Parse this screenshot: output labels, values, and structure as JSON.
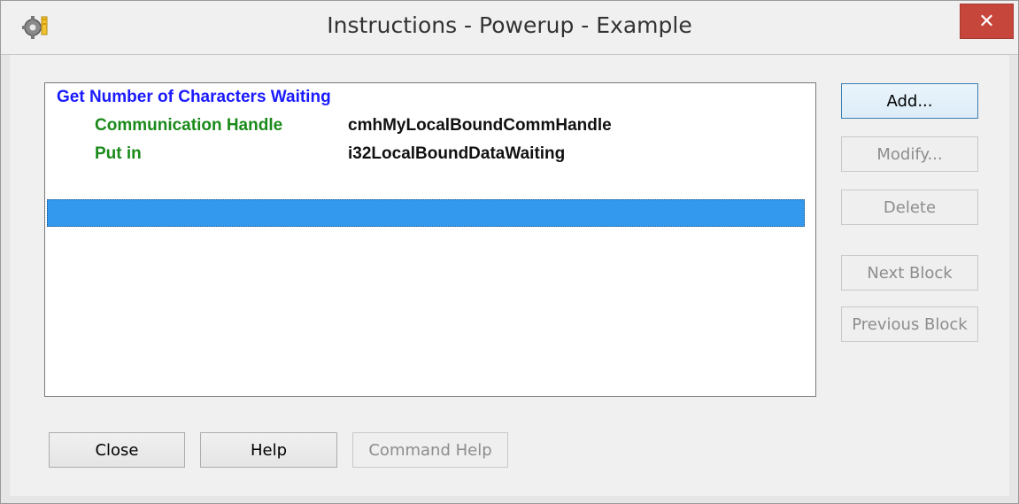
{
  "window": {
    "title": "Instructions - Powerup - Example",
    "close_glyph": "✕",
    "app_icon": "gear-icon"
  },
  "list": {
    "instruction": "Get Number of Characters Waiting",
    "params": [
      {
        "name": "Communication Handle",
        "value": "cmhMyLocalBoundCommHandle"
      },
      {
        "name": "Put in",
        "value": "i32LocalBoundDataWaiting"
      }
    ],
    "selected_row": "",
    "colors": {
      "instruction": "#1a1aff",
      "param_name": "#1a8a1a",
      "selection": "#3399ee"
    }
  },
  "side_buttons": {
    "add": "Add...",
    "modify": "Modify...",
    "delete": "Delete",
    "next_block": "Next Block",
    "previous_block": "Previous Block"
  },
  "bottom_buttons": {
    "close": "Close",
    "help": "Help",
    "command_help": "Command Help"
  }
}
